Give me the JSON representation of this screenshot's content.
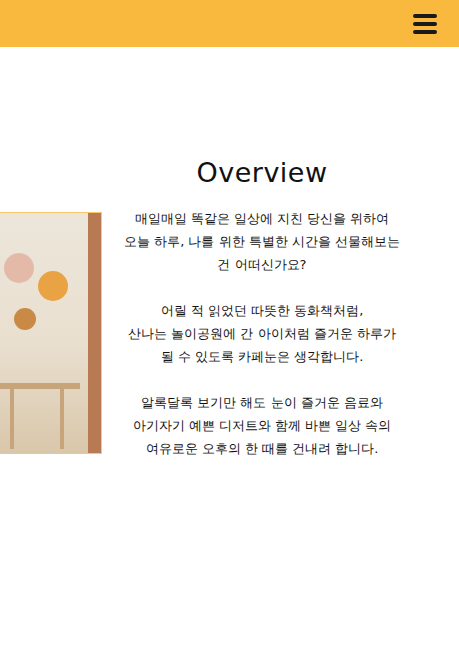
{
  "title": "Overview",
  "paragraphs": [
    [
      "매일매일 똑같은 일상에 지친 당신을 위하여",
      "오늘 하루, 나를 위한 특별한 시간을 선물해보는",
      "건 어떠신가요?"
    ],
    [
      "어릴 적 읽었던 따뜻한 동화책처럼,",
      "산나는 놀이공원에 간 아이처럼 즐거운 하루가",
      "될 수 있도록 카페눈은 생각합니다."
    ],
    [
      "알록달록 보기만 해도 눈이 즐거운 음료와",
      "아기자기 예쁜 디저트와 함께 바쁜 일상 속의",
      "여유로운 오후의 한 때를 건내려 합니다."
    ]
  ]
}
